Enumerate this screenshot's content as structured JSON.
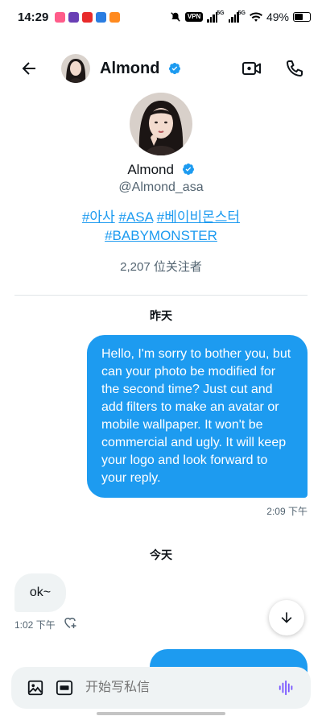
{
  "status_bar": {
    "time": "14:29",
    "vpn_label": "VPN",
    "network_1": "5G",
    "network_2": "5G",
    "battery_text": "49%",
    "battery_level": 0.49
  },
  "header": {
    "name": "Almond"
  },
  "profile": {
    "name": "Almond",
    "handle": "@Almond_asa",
    "tags": [
      "#아사",
      "#ASA",
      "#베이비몬스터",
      "#BABYMONSTER"
    ],
    "followers": "2,207 位关注者"
  },
  "conversation": {
    "day_1": "昨天",
    "outgoing_message": "Hello, I'm sorry to bother you, but can your photo be modified for the second time? Just cut and add filters to make an avatar or mobile wallpaper. It won't be commercial and ugly. It will keep your logo and look forward to your reply.",
    "outgoing_time": "2:09 下午",
    "day_2": "今天",
    "incoming_message": "ok~",
    "incoming_time": "1:02 下午"
  },
  "composer": {
    "placeholder": "开始写私信"
  },
  "colors": {
    "accent": "#1d9bf0",
    "incoming_bubble": "#eff3f4",
    "secondary_text": "#536471"
  }
}
